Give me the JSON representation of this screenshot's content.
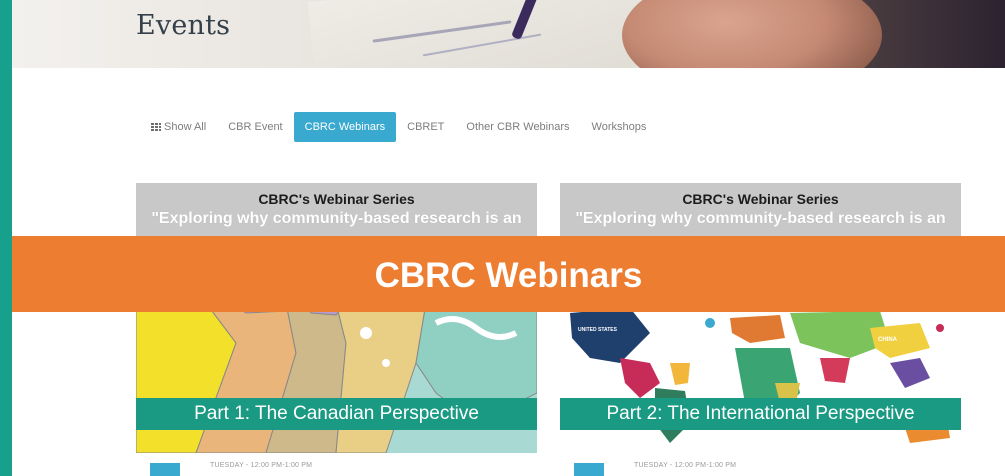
{
  "header": {
    "title": "Events"
  },
  "filters": {
    "show_all": "Show All",
    "items": [
      "CBR Event",
      "CBRC Webinars",
      "CBRET",
      "Other CBR Webinars",
      "Workshops"
    ],
    "active": "CBRC Webinars"
  },
  "cards": [
    {
      "series": "CBRC's Webinar Series",
      "description": "\"Exploring why community-based research is an",
      "part": "Part 1: The Canadian Perspective",
      "time": "TUESDAY - 12:00 PM-1:00 PM"
    },
    {
      "series": "CBRC's Webinar Series",
      "description": "\"Exploring why community-based research is an",
      "part": "Part 2: The International Perspective",
      "time": "TUESDAY - 12:00 PM-1:00 PM"
    }
  ],
  "overlay": {
    "label": "CBRC Webinars"
  },
  "map_labels": {
    "usa": "UNITED STATES",
    "china": "CHINA"
  },
  "colors": {
    "frame": "#17a08c",
    "accent_blue": "#3aa9cf",
    "orange": "#ed7d31",
    "part_bar": "#1a9a83"
  }
}
